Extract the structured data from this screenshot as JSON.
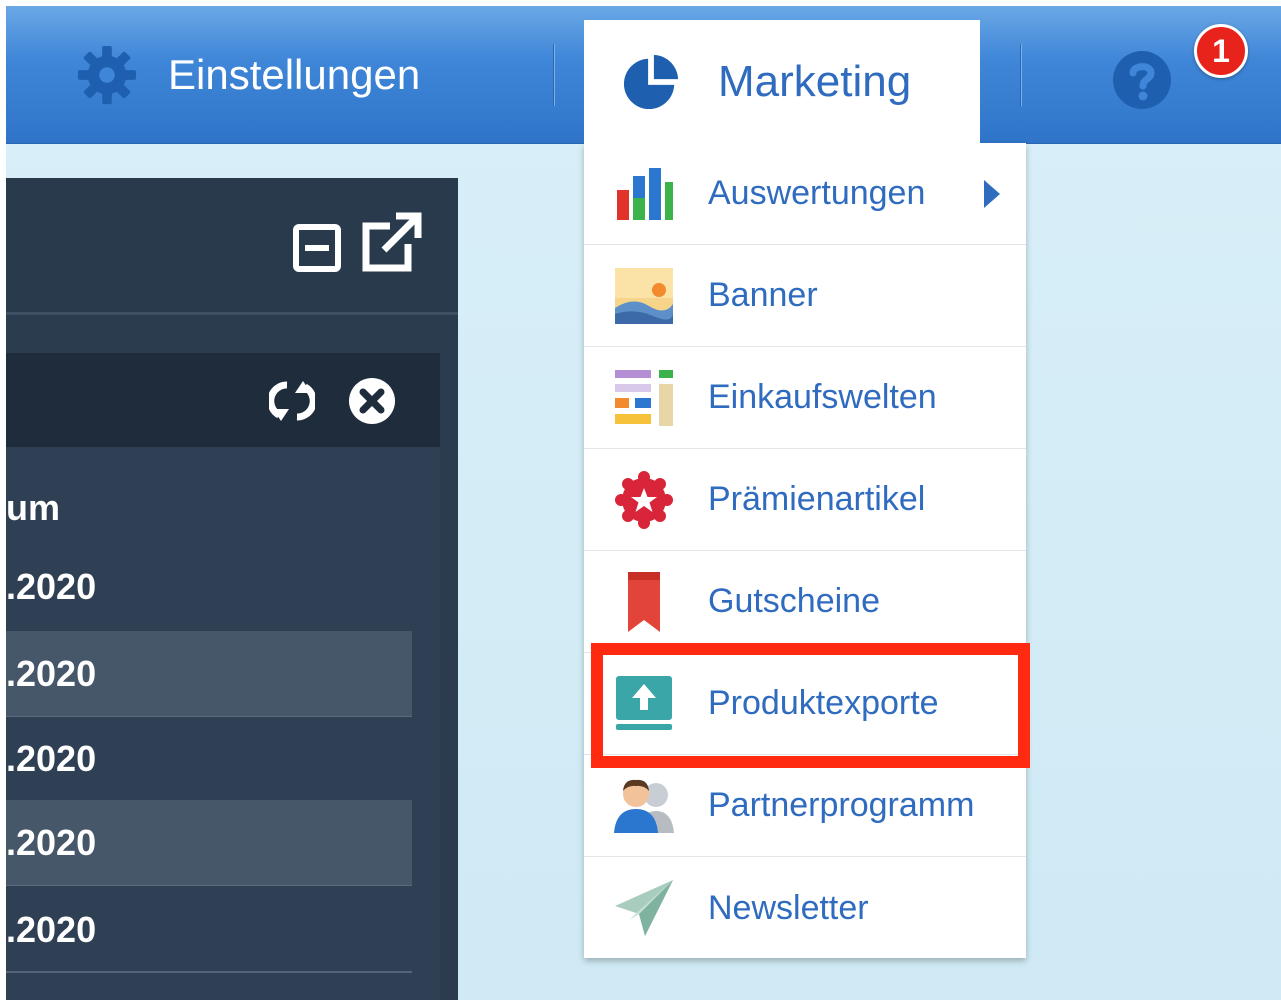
{
  "menubar": {
    "settings_label": "Einstellungen",
    "marketing_label": "Marketing",
    "help_icon": "question-circle-icon",
    "badge_count": "1",
    "badge_color": "#e8231b"
  },
  "dropdown": {
    "items": [
      {
        "label": "Auswertungen",
        "icon": "bar-chart-icon",
        "has_submenu": true
      },
      {
        "label": "Banner",
        "icon": "image-landscape-icon"
      },
      {
        "label": "Einkaufswelten",
        "icon": "layout-grid-icon"
      },
      {
        "label": "Prämienartikel",
        "icon": "award-badge-icon"
      },
      {
        "label": "Gutscheine",
        "icon": "bookmark-ribbon-icon"
      },
      {
        "label": "Produktexporte",
        "icon": "upload-export-icon",
        "highlighted": true
      },
      {
        "label": "Partnerprogramm",
        "icon": "users-partner-icon"
      },
      {
        "label": "Newsletter",
        "icon": "paper-plane-icon"
      }
    ],
    "highlight_color": "#ff2a10"
  },
  "panel": {
    "column_header": "um",
    "rows": [
      ".2020",
      ".2020",
      ".2020",
      ".2020",
      ".2020"
    ]
  },
  "colors": {
    "menubar_blue": "#3f86d8",
    "link_blue": "#2f6bbf",
    "panel_dark": "#2c3c4f"
  }
}
